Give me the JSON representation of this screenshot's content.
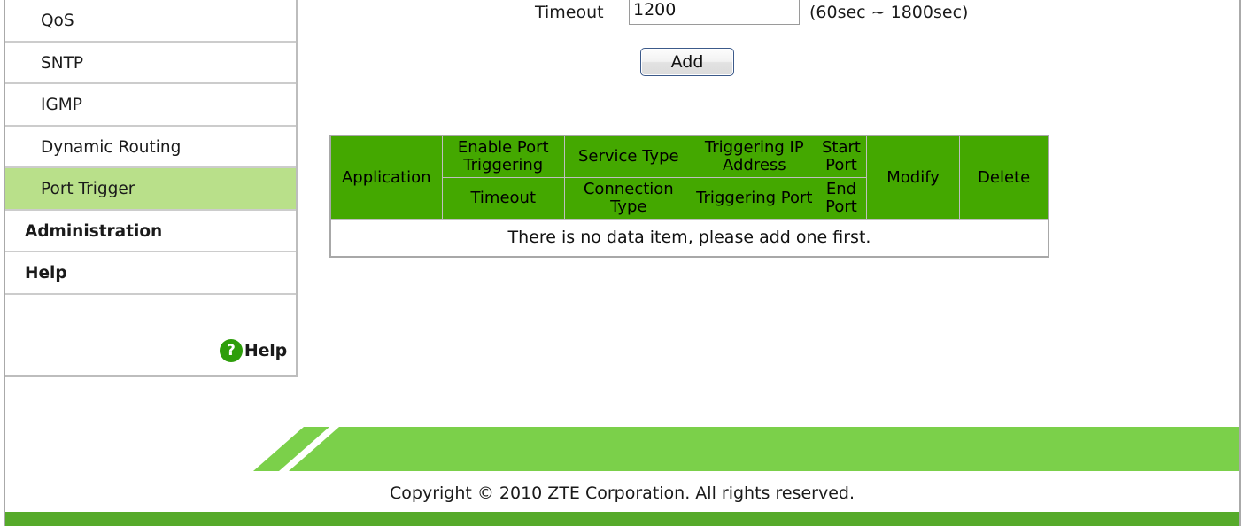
{
  "sidebar": {
    "items": [
      {
        "label": "QoS",
        "level": "sub",
        "active": false
      },
      {
        "label": "SNTP",
        "level": "sub",
        "active": false
      },
      {
        "label": "IGMP",
        "level": "sub",
        "active": false
      },
      {
        "label": "Dynamic Routing",
        "level": "sub",
        "active": false
      },
      {
        "label": "Port Trigger",
        "level": "sub",
        "active": true
      },
      {
        "label": "Administration",
        "level": "top",
        "active": false
      },
      {
        "label": "Help",
        "level": "top",
        "active": false
      }
    ],
    "help_link": {
      "label": "Help",
      "icon": "question-mark-icon",
      "icon_glyph": "?",
      "icon_color": "#2e9e0b"
    }
  },
  "form": {
    "timeout_label": "Timeout",
    "timeout_value": "1200",
    "timeout_placeholder": "",
    "timeout_hint": "(60sec ~ 1800sec)",
    "add_label": "Add"
  },
  "table": {
    "headers_row1": [
      "Application",
      "Enable Port Triggering",
      "Service Type",
      "Triggering IP Address",
      "Start Port",
      "Modify",
      "Delete"
    ],
    "headers_row2": [
      "Timeout",
      "Connection Type",
      "Triggering Port",
      "End Port"
    ],
    "empty_message": "There is no data item, please add one first.",
    "header_bg": "#44a800"
  },
  "footer": {
    "copyright": "Copyright © 2010 ZTE Corporation. All rights reserved.",
    "banner_color": "#7bd04a",
    "bar_color": "#56aa2a"
  }
}
